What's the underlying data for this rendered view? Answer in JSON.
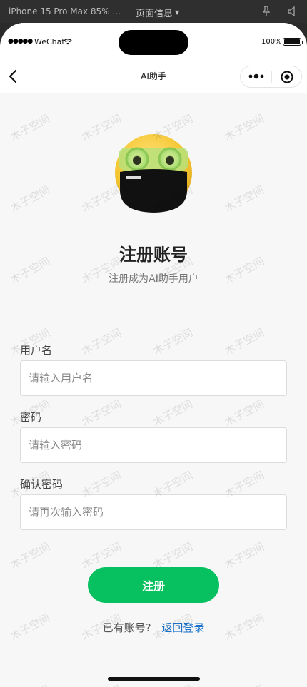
{
  "devtools": {
    "device_label": "iPhone 15 Pro Max 85% ...",
    "page_info_label": "页面信息"
  },
  "status_bar": {
    "signal": "●●●●●",
    "carrier": "WeChat",
    "battery_percent": "100%"
  },
  "nav": {
    "title": "AI助手"
  },
  "watermark": {
    "text": "木子空间"
  },
  "page": {
    "title": "注册账号",
    "subtitle": "注册成为AI助手用户"
  },
  "form": {
    "username": {
      "label": "用户名",
      "placeholder": "请输入用户名",
      "value": ""
    },
    "password": {
      "label": "密码",
      "placeholder": "请输入密码",
      "value": ""
    },
    "confirm_password": {
      "label": "确认密码",
      "placeholder": "请再次输入密码",
      "value": ""
    },
    "submit_label": "注册"
  },
  "footer": {
    "question": "已有账号?",
    "login_link": "返回登录"
  },
  "colors": {
    "accent": "#07c160",
    "link": "#1a72c9",
    "page_bg": "#f7f7f7"
  },
  "icons": [
    "back-arrow-icon",
    "more-dots-icon",
    "capsule-target-icon",
    "wifi-icon",
    "battery-icon",
    "pin-icon",
    "volume-icon",
    "caret-down-icon"
  ]
}
